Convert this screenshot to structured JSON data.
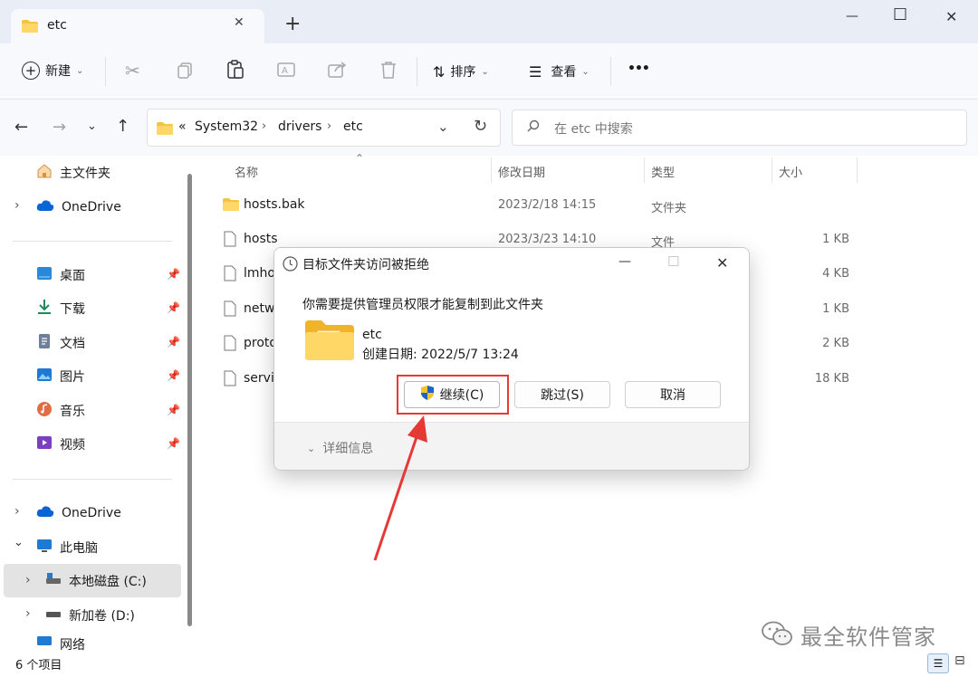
{
  "window": {
    "tab_title": "etc",
    "new_tab_symbol": "+",
    "controls": {
      "minimize": "—",
      "maximize": "☐",
      "close": "✕"
    }
  },
  "toolbar": {
    "new_label": "新建",
    "sort_label": "排序",
    "view_label": "查看",
    "more_label": "•••"
  },
  "address": {
    "crumbs": [
      "System32",
      "drivers",
      "etc"
    ],
    "overflow": "«",
    "search_placeholder": "在 etc 中搜索"
  },
  "sidebar": {
    "home": "主文件夹",
    "onedrive_top": "OneDrive",
    "pinned": [
      {
        "label": "桌面",
        "icon": "desktop-icon"
      },
      {
        "label": "下载",
        "icon": "download-icon"
      },
      {
        "label": "文档",
        "icon": "document-icon"
      },
      {
        "label": "图片",
        "icon": "picture-icon"
      },
      {
        "label": "音乐",
        "icon": "music-icon"
      },
      {
        "label": "视频",
        "icon": "video-icon"
      }
    ],
    "onedrive": "OneDrive",
    "this_pc": "此电脑",
    "drive_c": "本地磁盘 (C:)",
    "drive_d": "新加卷 (D:)",
    "network": "网络"
  },
  "columns": {
    "name": "名称",
    "modified": "修改日期",
    "type": "类型",
    "size": "大小"
  },
  "files": [
    {
      "name": "hosts.bak",
      "modified": "2023/2/18 14:15",
      "type": "文件夹",
      "size": "",
      "kind": "folder"
    },
    {
      "name": "hosts",
      "modified": "2023/3/23 14:10",
      "type": "文件",
      "size": "1 KB",
      "kind": "file"
    },
    {
      "name": "lmho",
      "modified": "",
      "type": "",
      "size": "4 KB",
      "kind": "file"
    },
    {
      "name": "netw",
      "modified": "",
      "type": "",
      "size": "1 KB",
      "kind": "file"
    },
    {
      "name": "proto",
      "modified": "",
      "type": "",
      "size": "2 KB",
      "kind": "file"
    },
    {
      "name": "servi",
      "modified": "",
      "type": "",
      "size": "18 KB",
      "kind": "file"
    }
  ],
  "status": {
    "count": "6 个项目"
  },
  "dialog": {
    "title": "目标文件夹访问被拒绝",
    "message": "你需要提供管理员权限才能复制到此文件夹",
    "folder_name": "etc",
    "created": "创建日期: 2022/5/7 13:24",
    "continue_label": "继续(C)",
    "skip_label": "跳过(S)",
    "cancel_label": "取消",
    "details_label": "详细信息"
  },
  "watermark": "最全软件管家",
  "colors": {
    "accent": "#0067c0",
    "annotation": "#e53935",
    "folder": "#f4c343"
  }
}
